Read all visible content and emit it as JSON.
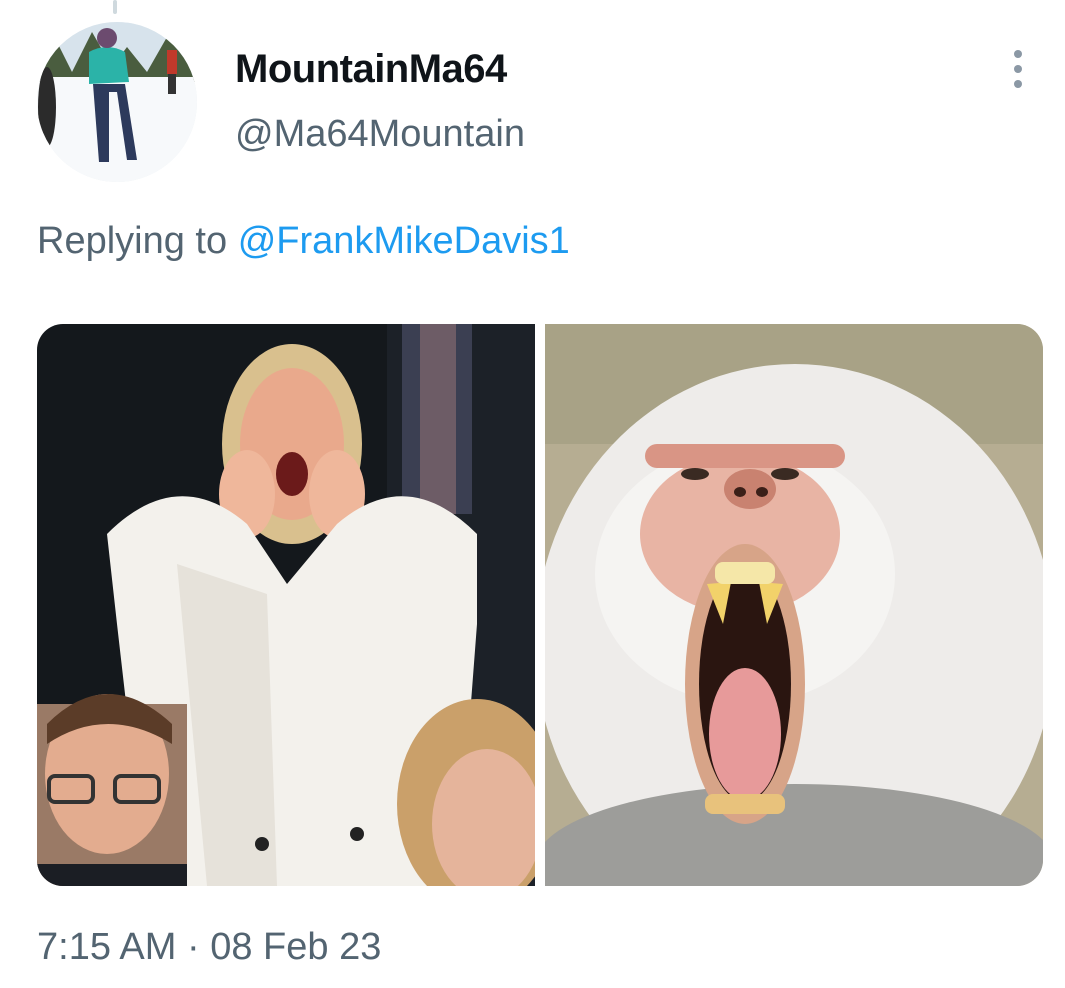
{
  "tweet": {
    "display_name": "MountainMa64",
    "handle": "@Ma64Mountain",
    "reply_prefix": "Replying to",
    "reply_to": "@FrankMikeDavis1",
    "time": "7:15 AM",
    "separator": "·",
    "date": "08 Feb 23"
  },
  "icons": {
    "more": "more-dots-icon"
  },
  "colors": {
    "text_primary": "#0f1419",
    "text_secondary": "#536471",
    "link": "#1d9bf0"
  }
}
